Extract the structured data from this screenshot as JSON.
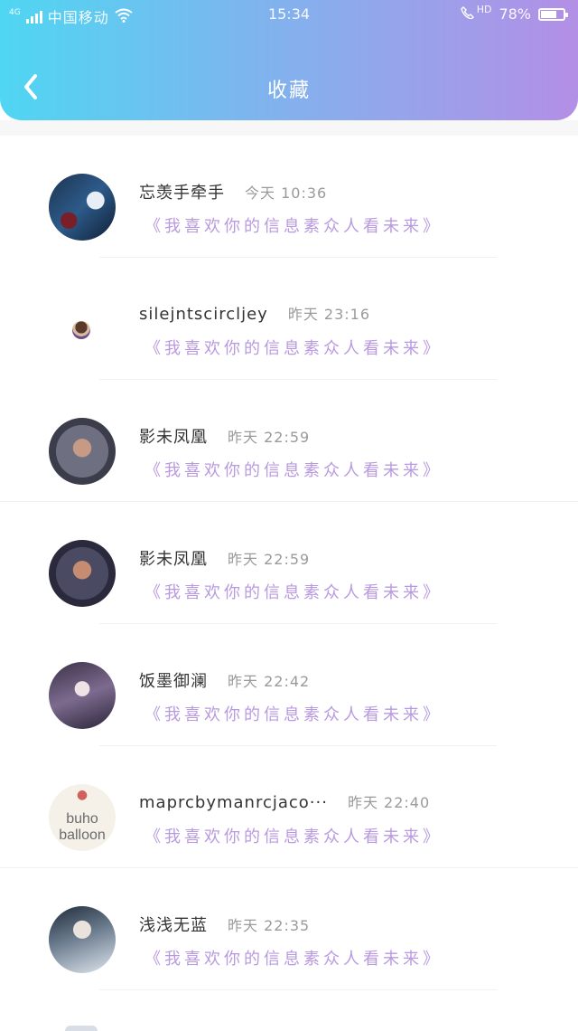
{
  "status_bar": {
    "network": "4G",
    "carrier": "中国移动",
    "time": "15:34",
    "hd": "HD",
    "battery": "78%",
    "battery_level": 0.78
  },
  "header": {
    "title": "收藏"
  },
  "items": [
    {
      "name": "忘羡手牵手",
      "time": "今天 10:36",
      "message": "《我喜欢你的信息素众人看未来》"
    },
    {
      "name": "silejntscircljey",
      "time": "昨天 23:16",
      "message": "《我喜欢你的信息素众人看未来》"
    },
    {
      "name": "影未凤凰",
      "time": "昨天 22:59",
      "message": "《我喜欢你的信息素众人看未来》"
    },
    {
      "name": "影未凤凰",
      "time": "昨天 22:59",
      "message": "《我喜欢你的信息素众人看未来》"
    },
    {
      "name": "饭墨御澜",
      "time": "昨天 22:42",
      "message": "《我喜欢你的信息素众人看未来》"
    },
    {
      "name": "maprcbymanrcjaco···",
      "time": "昨天 22:40",
      "message": "《我喜欢你的信息素众人看未来》",
      "avatar_text": [
        "buho",
        "balloon"
      ]
    },
    {
      "name": "浅浅无蓝",
      "time": "昨天 22:35",
      "message": "《我喜欢你的信息素众人看未来》"
    }
  ]
}
